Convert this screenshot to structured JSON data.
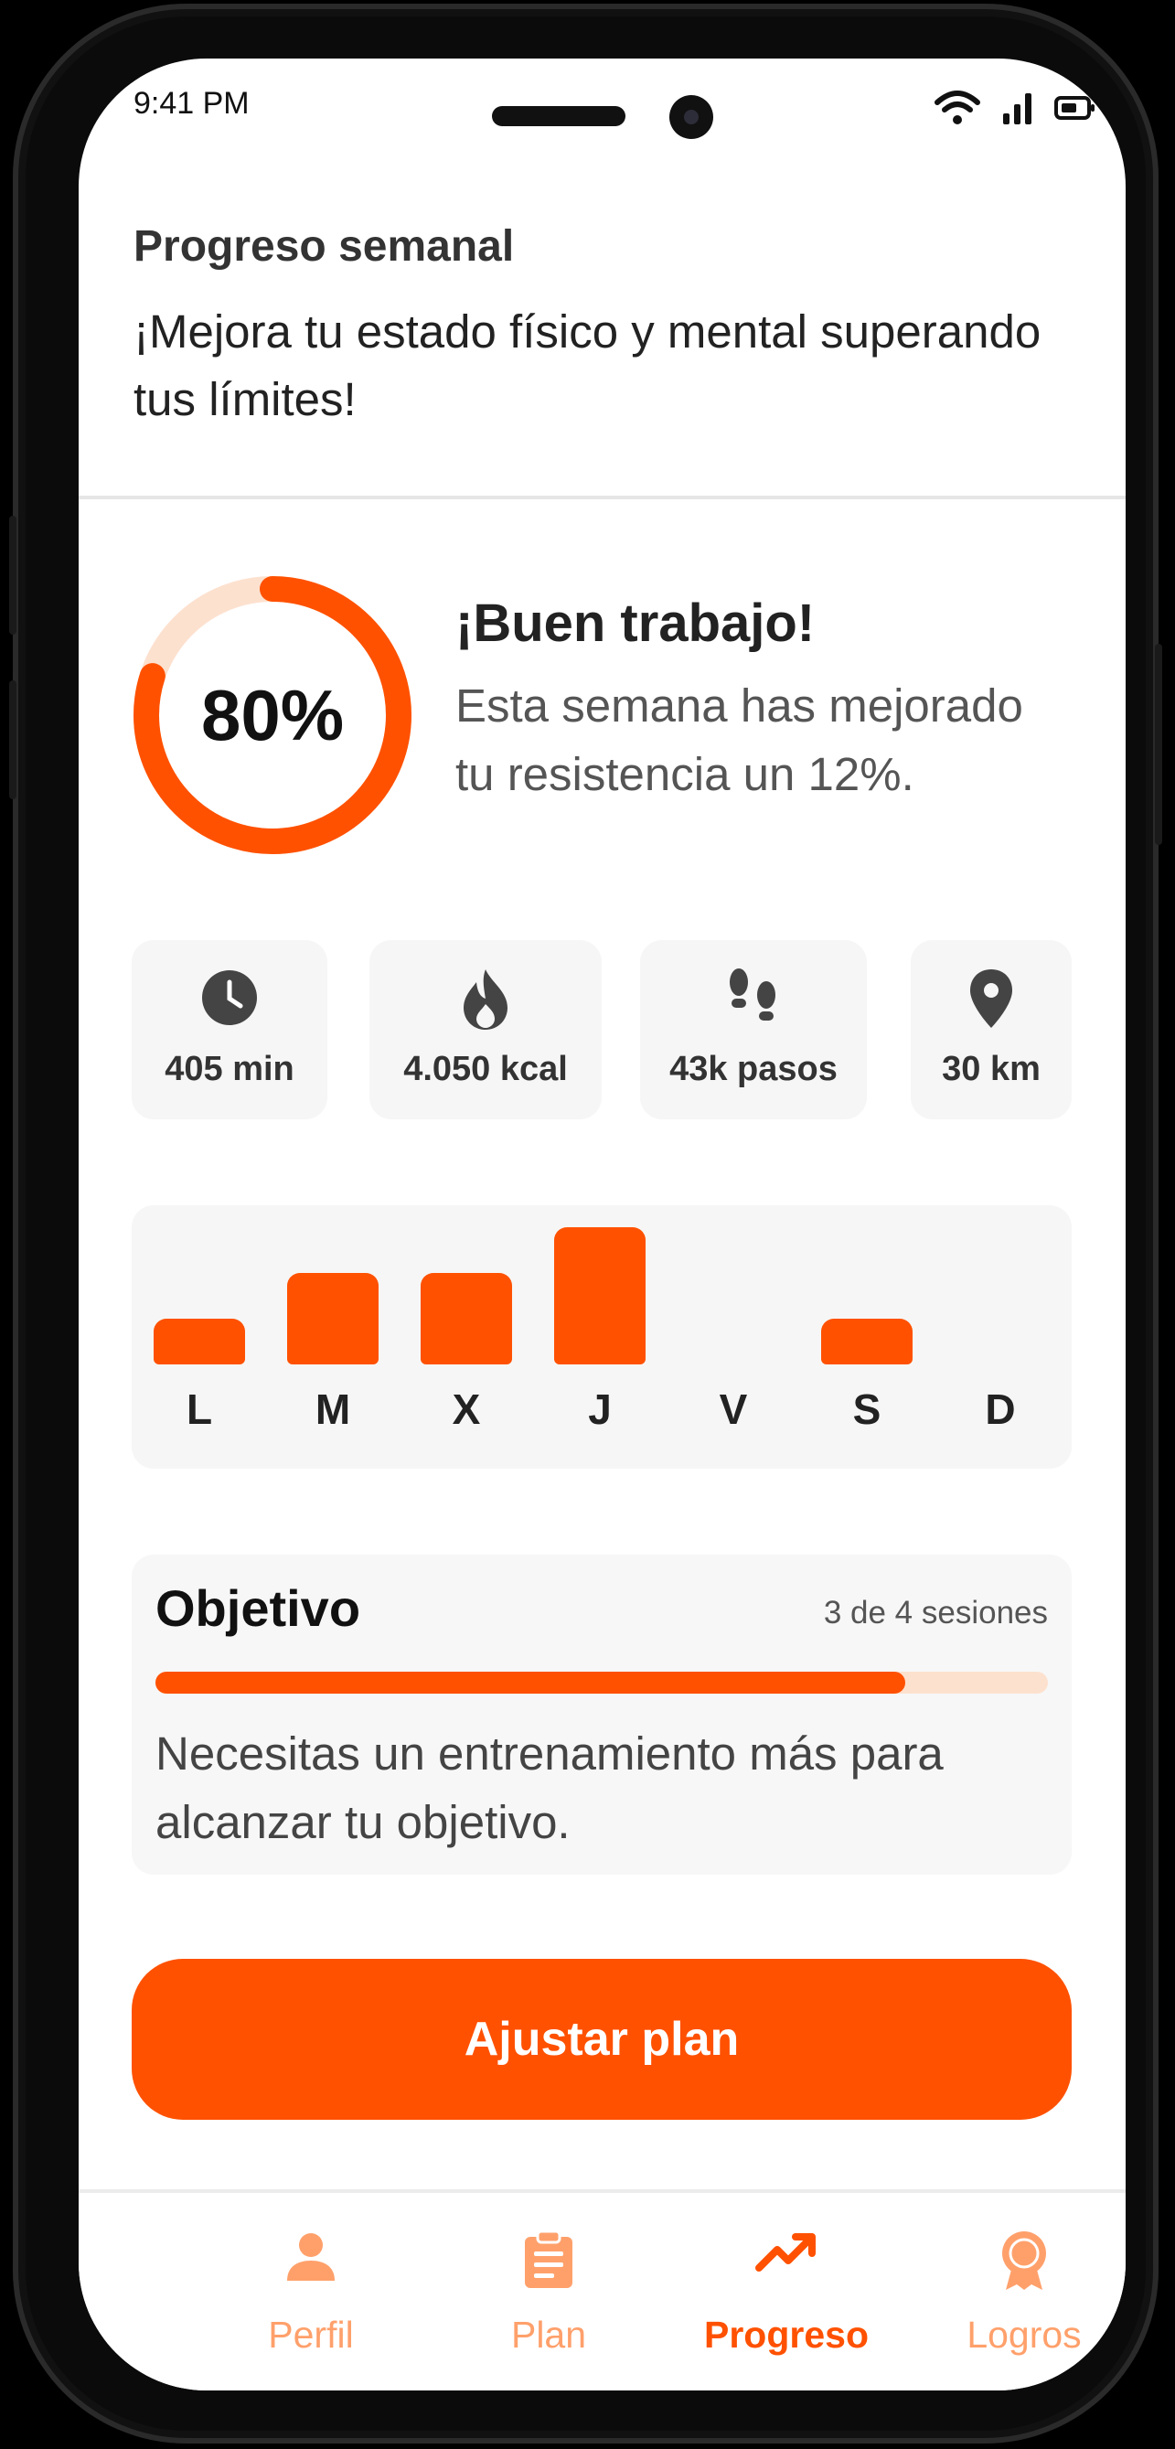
{
  "status_bar": {
    "time": "9:41 PM"
  },
  "header": {
    "title": "Progreso semanal",
    "subtitle": "¡Mejora tu estado físico y mental superando tus límites!"
  },
  "summary": {
    "progress_percent": 80,
    "progress_label": "80%",
    "title": "¡Buen trabajo!",
    "text": "Esta semana has mejorado tu resistencia un 12%."
  },
  "stats": [
    {
      "icon": "clock-icon",
      "value": "405 min"
    },
    {
      "icon": "flame-icon",
      "value": "4.050 kcal"
    },
    {
      "icon": "footprints-icon",
      "value": "43k pasos"
    },
    {
      "icon": "location-pin-icon",
      "value": "30 km"
    }
  ],
  "chart_data": {
    "type": "bar",
    "categories": [
      "L",
      "M",
      "X",
      "J",
      "V",
      "S",
      "D"
    ],
    "values": [
      1,
      2,
      2,
      3,
      0,
      1,
      0
    ],
    "ylim": [
      0,
      3
    ],
    "color": "#ff5100"
  },
  "goal": {
    "title": "Objetivo",
    "count_text": "3 de 4 sesiones",
    "progress_fraction": 0.84,
    "message": "Necesitas un entrenamiento más para alcanzar tu objetivo."
  },
  "cta": {
    "label": "Ajustar plan"
  },
  "nav": {
    "items": [
      {
        "label": "Perfil",
        "icon": "user-icon",
        "active": false
      },
      {
        "label": "Plan",
        "icon": "clipboard-icon",
        "active": false
      },
      {
        "label": "Progreso",
        "icon": "trending-up-icon",
        "active": true
      },
      {
        "label": "Logros",
        "icon": "medal-icon",
        "active": false
      }
    ]
  },
  "colors": {
    "accent": "#ff5100",
    "accent_light": "#fde1cf",
    "nav_inactive": "#ffa06b",
    "card_bg": "#f6f6f6"
  }
}
